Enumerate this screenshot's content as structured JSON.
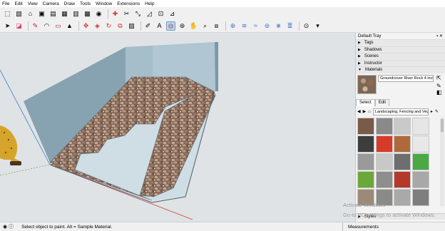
{
  "menu": [
    "File",
    "Edit",
    "View",
    "Camera",
    "Draw",
    "Tools",
    "Window",
    "Extensions",
    "Help"
  ],
  "toolbar1_icons": [
    "select-icon",
    "paint-icon",
    "home-icon",
    "warehouse-icon",
    "layout-icon",
    "folder-icon",
    "save-icon",
    "print-icon",
    "user-icon",
    "move-icon",
    "rotate-icon",
    "scale-icon",
    "dimension-icon",
    "text-icon",
    "axes-icon"
  ],
  "toolbar2_icons": [
    "arrow-icon",
    "eraser-icon",
    "pencil-icon",
    "arc-icon",
    "rectangle-icon",
    "push-pull-icon",
    "follow-me-icon",
    "offset-icon",
    "rotate-icon",
    "scale-icon",
    "tape-icon",
    "protractor-icon",
    "paint-bucket-icon",
    "orbit-icon",
    "pan-icon",
    "zoom-icon",
    "zoom-window-icon",
    "zoom-extents-icon",
    "sandbox-icon",
    "sandbox-smoove-icon",
    "sandbox-stamp-icon",
    "geo-icon"
  ],
  "tray": {
    "title": "Default Tray",
    "panels": [
      "Tags",
      "Shadows",
      "Scenes",
      "Instructor",
      "Materials"
    ],
    "material_name": "Groundcover River Rock 4 inch",
    "tabs": [
      "Select",
      "Edit"
    ],
    "library": "Landscaping, Fencing and Veg",
    "styles_label": "Styles"
  },
  "status": {
    "message": "Select object to paint. Alt = Sample Material.",
    "measurements_label": "Measurements"
  },
  "watermark": {
    "line1": "Activate Windows",
    "line2": "Go to PC settings to activate Windows."
  },
  "swatch_colors": [
    "#7a5a48",
    "#8a8a8a",
    "#c9c9c9",
    "#e6e6e6",
    "#3d3d3d",
    "#d83a2a",
    "#b06a3a",
    "#e8e8e8",
    "#9a9a9a",
    "#c8c8c8",
    "#6e6e6e",
    "#4ba845",
    "#6aa83a",
    "#8e8e8e",
    "#b33a2a",
    "#a8a8a8",
    "#9c8a78",
    "#8a8a88",
    "#a9a9a9",
    "#7e7e7e"
  ]
}
